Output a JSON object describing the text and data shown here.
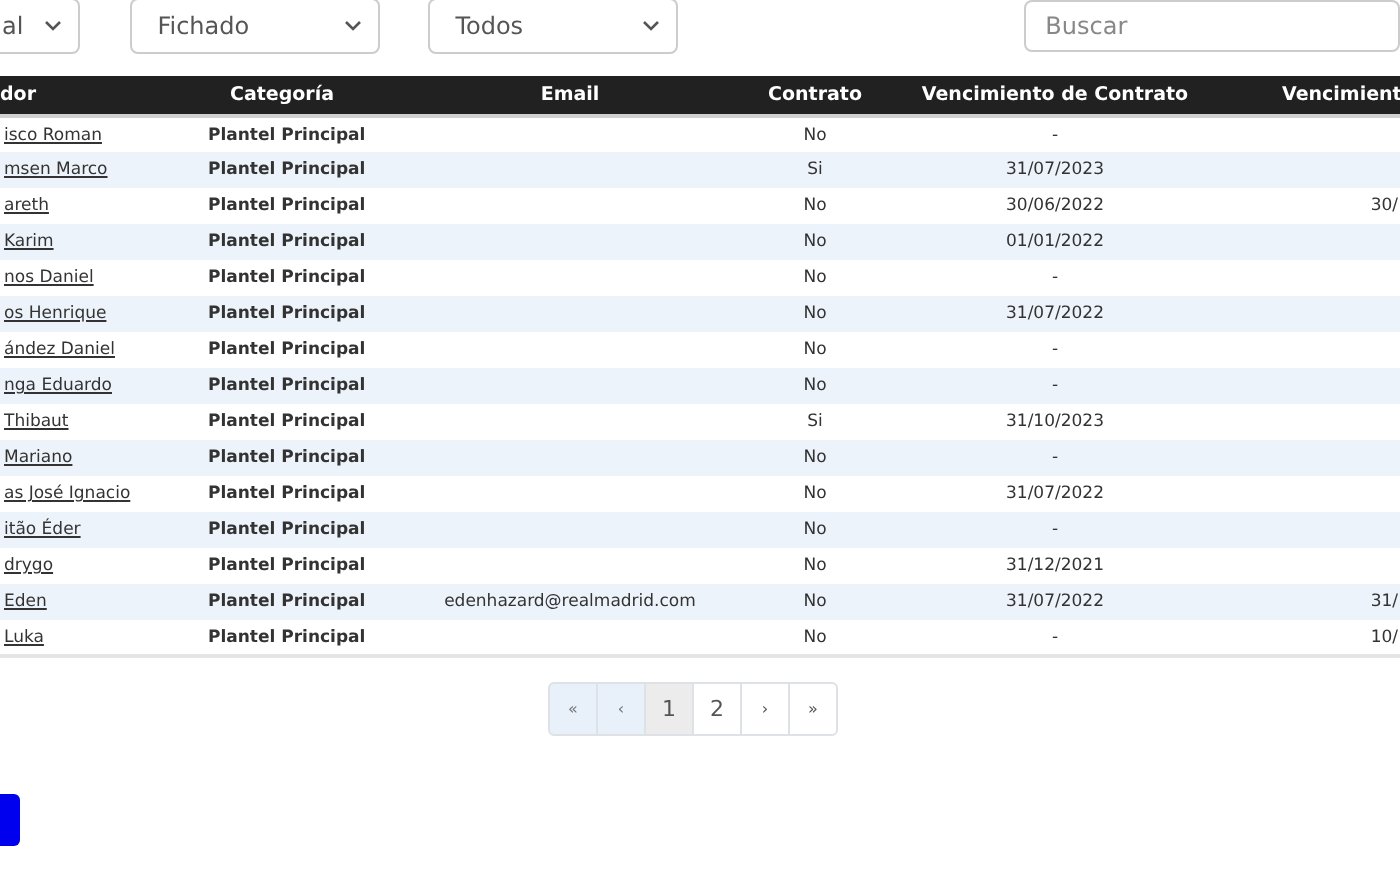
{
  "filters": [
    {
      "value": "al"
    },
    {
      "value": "Fichado"
    },
    {
      "value": "Todos"
    }
  ],
  "search": {
    "placeholder": "Buscar"
  },
  "table": {
    "columns": [
      "dor",
      "Categoría",
      "Email",
      "Contrato",
      "Vencimiento de Contrato",
      "Vencimient"
    ],
    "rows": [
      {
        "player": "isco Roman",
        "category": "Plantel Principal",
        "contract": "No",
        "contract_expiry": "-"
      },
      {
        "player": "msen Marco",
        "category": "Plantel Principal",
        "contract": "Si",
        "contract_expiry": "31/07/2023"
      },
      {
        "player": "areth",
        "category": "Plantel Principal",
        "contract": "No",
        "contract_expiry": "30/06/2022",
        "column_6": "30/"
      },
      {
        "player": "Karim",
        "category": "Plantel Principal",
        "contract": "No",
        "contract_expiry": "01/01/2022"
      },
      {
        "player": "nos Daniel",
        "category": "Plantel Principal",
        "contract": "No",
        "contract_expiry": "-"
      },
      {
        "player": "os Henrique",
        "category": "Plantel Principal",
        "contract": "No",
        "contract_expiry": "31/07/2022"
      },
      {
        "player": "ández Daniel",
        "category": "Plantel Principal",
        "contract": "No",
        "contract_expiry": "-"
      },
      {
        "player": "nga Eduardo",
        "category": "Plantel Principal",
        "contract": "No",
        "contract_expiry": "-"
      },
      {
        "player": "Thibaut",
        "category": "Plantel Principal",
        "contract": "Si",
        "contract_expiry": "31/10/2023"
      },
      {
        "player": "Mariano",
        "category": "Plantel Principal",
        "contract": "No",
        "contract_expiry": "-"
      },
      {
        "player": "as José Ignacio",
        "category": "Plantel Principal",
        "contract": "No",
        "contract_expiry": "31/07/2022"
      },
      {
        "player": "itão Éder",
        "category": "Plantel Principal",
        "contract": "No",
        "contract_expiry": "-"
      },
      {
        "player": "drygo",
        "category": "Plantel Principal",
        "contract": "No",
        "contract_expiry": "31/12/2021"
      },
      {
        "player": "Eden",
        "category": "Plantel Principal",
        "email": "edenhazard@realmadrid.com",
        "contract": "No",
        "contract_expiry": "31/07/2022",
        "column_6": "31/"
      },
      {
        "player": "Luka",
        "category": "Plantel Principal",
        "contract": "No",
        "contract_expiry": "-",
        "column_6": "10/"
      }
    ]
  },
  "pagination": [
    {
      "label": "«",
      "disabled": true,
      "selected": false
    },
    {
      "label": "‹",
      "disabled": true,
      "selected": false
    },
    {
      "label": "1",
      "disabled": false,
      "selected": true
    },
    {
      "label": "2",
      "disabled": false,
      "selected": false
    },
    {
      "label": "›",
      "disabled": false,
      "selected": false
    },
    {
      "label": "»",
      "disabled": false,
      "selected": false
    }
  ]
}
